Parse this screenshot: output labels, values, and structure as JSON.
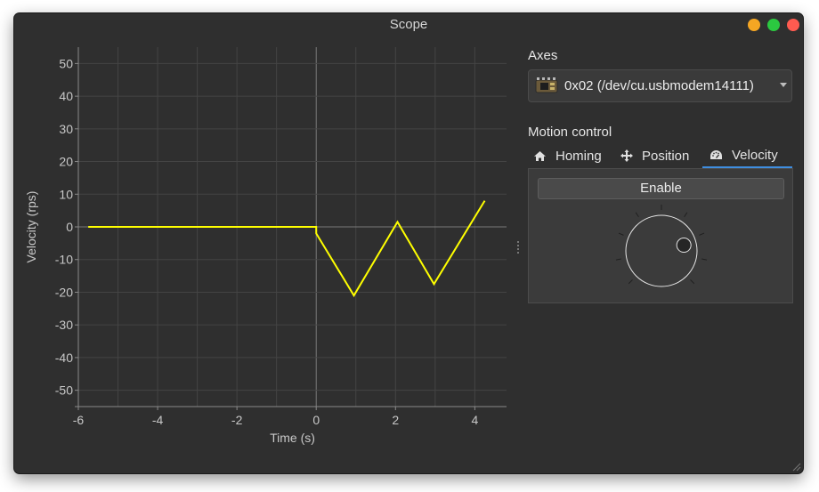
{
  "window": {
    "title": "Scope"
  },
  "panel": {
    "axes_label": "Axes",
    "axis_device": "0x02 (/dev/cu.usbmodem14111)",
    "motion_label": "Motion control",
    "tabs": [
      {
        "label": "Homing",
        "icon": "home-icon"
      },
      {
        "label": "Position",
        "icon": "move-arrows-icon"
      },
      {
        "label": "Velocity",
        "icon": "gauge-icon",
        "active": true
      }
    ],
    "enable_label": "Enable",
    "dial_value_fraction": 0.78
  },
  "chart_data": {
    "type": "line",
    "xlabel": "Time (s)",
    "ylabel": "Velocity (rps)",
    "xlim": [
      -6.0,
      4.8
    ],
    "ylim": [
      -55,
      55
    ],
    "xticks": [
      -6,
      -4,
      -2,
      0,
      2,
      4
    ],
    "xtick_labels": [
      "-6",
      "-4",
      "-2",
      "0",
      "2",
      "4"
    ],
    "yticks": [
      50,
      40,
      30,
      20,
      10,
      0,
      -10,
      -20,
      -30,
      -40,
      -50
    ],
    "ytick_labels": [
      "50",
      "40",
      "30",
      "20",
      "10",
      "0",
      "-10",
      "-20",
      "-30",
      "-40",
      "-50"
    ],
    "grid": true,
    "color": "#ffff00",
    "series": [
      {
        "x": [
          -5.75,
          0.0,
          0.0,
          0.95,
          2.05,
          2.97,
          4.25
        ],
        "y": [
          0,
          0,
          -2,
          -21,
          1.5,
          -17.5,
          8
        ]
      }
    ]
  }
}
